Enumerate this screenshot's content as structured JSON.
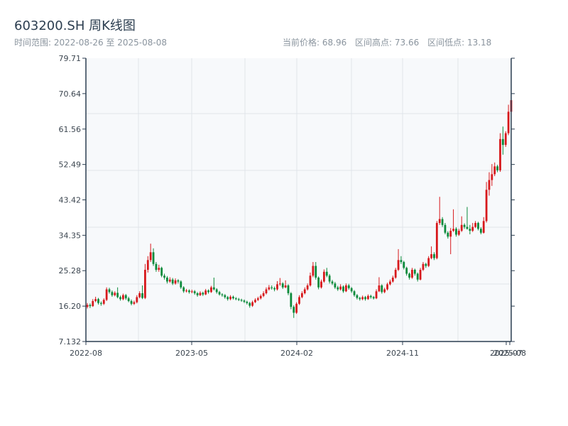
{
  "header": {
    "title": "603200.SH 周K线图",
    "range_label": "时间范围: 2022-08-26 至 2025-08-08",
    "current_price": "当前价格: 68.96",
    "range_high": "区间高点: 73.66",
    "range_low": "区间低点: 13.18"
  },
  "chart_data": {
    "type": "candlestick",
    "title": "603200.SH 周K线图",
    "frequency": "weekly",
    "start_date": "2022-08-26",
    "end_date": "2025-08-08",
    "ylim": [
      7.132,
      79.71
    ],
    "y_ticks": [
      "79.71",
      "70.64",
      "61.56",
      "52.49",
      "43.42",
      "34.35",
      "25.28",
      "16.20",
      "7.132"
    ],
    "x_ticks": [
      "2022-08",
      "2023-05",
      "2024-02",
      "2024-11",
      "2025-07",
      "2025-08"
    ],
    "grid": true,
    "colors": {
      "up": "#d7191c",
      "down": "#0a8a3a",
      "background": "#f7f9fb",
      "axis": "#2c3e50",
      "grid": "#e1e5ea"
    },
    "ohlc_columns": [
      "open",
      "high",
      "low",
      "close"
    ],
    "ohlc": [
      [
        16.0,
        17.0,
        15.6,
        16.5
      ],
      [
        16.5,
        16.9,
        15.7,
        16.2
      ],
      [
        16.2,
        18.0,
        16.0,
        17.5
      ],
      [
        17.5,
        18.6,
        17.2,
        18.0
      ],
      [
        18.0,
        18.3,
        16.6,
        17.0
      ],
      [
        17.0,
        17.4,
        16.3,
        16.8
      ],
      [
        16.8,
        18.2,
        16.5,
        17.8
      ],
      [
        17.8,
        21.0,
        17.5,
        20.5
      ],
      [
        20.5,
        20.9,
        19.4,
        19.8
      ],
      [
        19.8,
        20.2,
        18.6,
        19.0
      ],
      [
        19.0,
        20.0,
        18.7,
        19.6
      ],
      [
        19.6,
        21.0,
        18.2,
        18.5
      ],
      [
        18.5,
        18.9,
        17.6,
        18.0
      ],
      [
        18.0,
        19.4,
        17.7,
        19.0
      ],
      [
        19.0,
        19.3,
        17.8,
        18.2
      ],
      [
        18.2,
        18.6,
        17.2,
        17.5
      ],
      [
        17.5,
        17.9,
        16.4,
        16.8
      ],
      [
        16.8,
        17.6,
        16.5,
        17.2
      ],
      [
        17.2,
        19.0,
        16.9,
        18.5
      ],
      [
        18.5,
        20.0,
        18.2,
        19.5
      ],
      [
        19.5,
        21.5,
        18.0,
        18.3
      ],
      [
        18.3,
        27.0,
        18.0,
        25.5
      ],
      [
        25.5,
        29.0,
        24.8,
        28.0
      ],
      [
        28.0,
        32.2,
        27.5,
        30.0
      ],
      [
        30.0,
        31.0,
        26.5,
        27.0
      ],
      [
        27.0,
        27.5,
        25.0,
        25.5
      ],
      [
        25.5,
        26.8,
        25.0,
        26.0
      ],
      [
        26.0,
        26.3,
        23.6,
        24.0
      ],
      [
        24.0,
        24.5,
        23.0,
        23.5
      ],
      [
        23.5,
        23.9,
        22.0,
        22.5
      ],
      [
        22.5,
        23.6,
        22.2,
        23.0
      ],
      [
        23.0,
        23.4,
        21.6,
        22.0
      ],
      [
        22.0,
        23.3,
        21.7,
        22.8
      ],
      [
        22.8,
        23.1,
        22.0,
        22.5
      ],
      [
        22.5,
        22.8,
        20.6,
        21.0
      ],
      [
        21.0,
        21.3,
        19.6,
        20.0
      ],
      [
        20.0,
        20.6,
        19.7,
        20.2
      ],
      [
        20.2,
        20.5,
        19.4,
        19.8
      ],
      [
        19.8,
        20.4,
        19.5,
        20.0
      ],
      [
        20.0,
        20.3,
        19.1,
        19.5
      ],
      [
        19.5,
        19.8,
        18.6,
        19.0
      ],
      [
        19.0,
        20.0,
        18.8,
        19.6
      ],
      [
        19.6,
        19.9,
        18.8,
        19.2
      ],
      [
        19.2,
        20.6,
        19.0,
        20.2
      ],
      [
        20.2,
        20.5,
        19.4,
        19.8
      ],
      [
        19.8,
        21.4,
        19.6,
        21.0
      ],
      [
        21.0,
        23.5,
        20.2,
        20.5
      ],
      [
        20.5,
        20.8,
        19.4,
        19.8
      ],
      [
        19.8,
        20.1,
        18.9,
        19.2
      ],
      [
        19.2,
        19.5,
        18.6,
        19.0
      ],
      [
        19.0,
        19.3,
        18.1,
        18.5
      ],
      [
        18.5,
        18.8,
        17.6,
        18.0
      ],
      [
        18.0,
        19.0,
        17.7,
        18.6
      ],
      [
        18.6,
        18.9,
        17.9,
        18.2
      ],
      [
        18.2,
        18.5,
        17.7,
        18.0
      ],
      [
        18.0,
        18.3,
        17.5,
        17.8
      ],
      [
        17.8,
        18.1,
        17.3,
        17.6
      ],
      [
        17.6,
        17.9,
        17.0,
        17.3
      ],
      [
        17.3,
        17.6,
        16.6,
        17.0
      ],
      [
        17.0,
        17.3,
        15.8,
        16.3
      ],
      [
        16.3,
        17.6,
        16.0,
        17.2
      ],
      [
        17.2,
        18.2,
        17.0,
        17.8
      ],
      [
        17.8,
        18.6,
        17.5,
        18.2
      ],
      [
        18.2,
        19.2,
        17.9,
        18.8
      ],
      [
        18.8,
        20.0,
        18.5,
        19.5
      ],
      [
        19.5,
        21.0,
        19.2,
        20.5
      ],
      [
        20.5,
        21.6,
        20.2,
        21.0
      ],
      [
        21.0,
        21.5,
        20.4,
        20.8
      ],
      [
        20.8,
        21.2,
        20.0,
        20.5
      ],
      [
        20.5,
        22.6,
        20.2,
        21.8
      ],
      [
        21.8,
        23.4,
        21.4,
        22.0
      ],
      [
        22.0,
        22.3,
        20.6,
        21.0
      ],
      [
        21.0,
        22.8,
        20.8,
        21.5
      ],
      [
        21.5,
        21.8,
        19.0,
        19.5
      ],
      [
        19.5,
        19.8,
        15.4,
        16.0
      ],
      [
        16.0,
        16.4,
        13.18,
        14.5
      ],
      [
        14.5,
        17.2,
        14.2,
        16.8
      ],
      [
        16.8,
        19.0,
        16.5,
        18.5
      ],
      [
        18.5,
        20.0,
        18.2,
        19.5
      ],
      [
        19.5,
        21.0,
        19.2,
        20.5
      ],
      [
        20.5,
        22.0,
        20.2,
        21.5
      ],
      [
        21.5,
        24.8,
        21.2,
        24.0
      ],
      [
        24.0,
        27.5,
        23.6,
        26.5
      ],
      [
        26.5,
        27.5,
        23.0,
        23.5
      ],
      [
        23.5,
        23.8,
        20.5,
        21.0
      ],
      [
        21.0,
        23.0,
        20.7,
        22.5
      ],
      [
        22.5,
        25.6,
        22.2,
        25.0
      ],
      [
        25.0,
        26.0,
        23.6,
        24.0
      ],
      [
        24.0,
        24.4,
        22.0,
        22.5
      ],
      [
        22.5,
        22.9,
        21.6,
        22.0
      ],
      [
        22.0,
        22.4,
        20.6,
        21.0
      ],
      [
        21.0,
        21.4,
        20.1,
        20.5
      ],
      [
        20.5,
        21.8,
        20.2,
        21.2
      ],
      [
        21.2,
        21.5,
        19.6,
        20.0
      ],
      [
        20.0,
        22.0,
        19.8,
        21.5
      ],
      [
        21.5,
        21.9,
        20.4,
        20.8
      ],
      [
        20.8,
        21.1,
        19.6,
        20.0
      ],
      [
        20.0,
        20.3,
        18.6,
        19.0
      ],
      [
        19.0,
        19.3,
        17.9,
        18.3
      ],
      [
        18.3,
        18.6,
        17.6,
        18.0
      ],
      [
        18.0,
        18.9,
        17.7,
        18.5
      ],
      [
        18.5,
        18.8,
        17.6,
        18.0
      ],
      [
        18.0,
        19.2,
        17.8,
        18.8
      ],
      [
        18.8,
        19.1,
        18.1,
        18.5
      ],
      [
        18.5,
        18.8,
        17.9,
        18.2
      ],
      [
        18.2,
        20.5,
        18.0,
        20.0
      ],
      [
        20.0,
        23.6,
        19.8,
        21.5
      ],
      [
        21.5,
        21.8,
        19.4,
        19.8
      ],
      [
        19.8,
        20.9,
        19.5,
        20.5
      ],
      [
        20.5,
        22.2,
        20.2,
        21.8
      ],
      [
        21.8,
        23.0,
        21.5,
        22.5
      ],
      [
        22.5,
        24.0,
        22.2,
        23.5
      ],
      [
        23.5,
        26.0,
        23.2,
        25.5
      ],
      [
        25.5,
        30.8,
        25.2,
        28.0
      ],
      [
        28.0,
        29.0,
        27.0,
        27.5
      ],
      [
        27.5,
        27.8,
        25.6,
        26.0
      ],
      [
        26.0,
        26.3,
        24.0,
        24.5
      ],
      [
        24.5,
        24.8,
        23.0,
        23.5
      ],
      [
        23.5,
        26.0,
        23.2,
        25.5
      ],
      [
        25.5,
        25.8,
        24.0,
        24.5
      ],
      [
        24.5,
        24.8,
        22.5,
        23.0
      ],
      [
        23.0,
        26.0,
        22.8,
        25.5
      ],
      [
        25.5,
        27.5,
        25.2,
        27.0
      ],
      [
        27.0,
        27.3,
        26.0,
        26.5
      ],
      [
        26.5,
        29.0,
        26.2,
        28.5
      ],
      [
        28.5,
        31.5,
        28.2,
        29.5
      ],
      [
        29.5,
        30.0,
        28.0,
        28.5
      ],
      [
        28.5,
        38.0,
        28.2,
        37.5
      ],
      [
        37.5,
        44.2,
        37.0,
        38.5
      ],
      [
        38.5,
        39.0,
        36.5,
        37.0
      ],
      [
        37.0,
        37.5,
        34.6,
        35.0
      ],
      [
        35.0,
        35.4,
        33.5,
        34.0
      ],
      [
        34.0,
        36.2,
        29.5,
        35.5
      ],
      [
        35.5,
        41.0,
        35.2,
        36.0
      ],
      [
        36.0,
        36.4,
        34.0,
        34.5
      ],
      [
        34.5,
        36.0,
        34.2,
        35.5
      ],
      [
        35.5,
        39.2,
        35.2,
        37.0
      ],
      [
        37.0,
        37.4,
        36.0,
        36.5
      ],
      [
        36.5,
        41.6,
        35.8,
        36.0
      ],
      [
        36.0,
        37.0,
        34.6,
        35.5
      ],
      [
        35.5,
        37.5,
        35.2,
        36.5
      ],
      [
        36.5,
        38.0,
        36.2,
        37.5
      ],
      [
        37.5,
        37.8,
        35.6,
        36.0
      ],
      [
        36.0,
        36.4,
        34.6,
        35.0
      ],
      [
        35.0,
        39.0,
        34.8,
        38.0
      ],
      [
        38.0,
        48.0,
        37.6,
        46.0
      ],
      [
        46.0,
        50.5,
        44.5,
        48.5
      ],
      [
        48.5,
        52.6,
        47.0,
        50.0
      ],
      [
        50.0,
        53.0,
        49.5,
        52.0
      ],
      [
        52.0,
        52.4,
        50.5,
        51.0
      ],
      [
        51.0,
        60.5,
        50.6,
        59.0
      ],
      [
        59.0,
        62.2,
        55.0,
        57.5
      ],
      [
        57.5,
        61.0,
        57.0,
        60.5
      ],
      [
        60.5,
        67.8,
        60.0,
        66.0
      ],
      [
        66.0,
        73.66,
        65.5,
        68.96
      ]
    ]
  }
}
